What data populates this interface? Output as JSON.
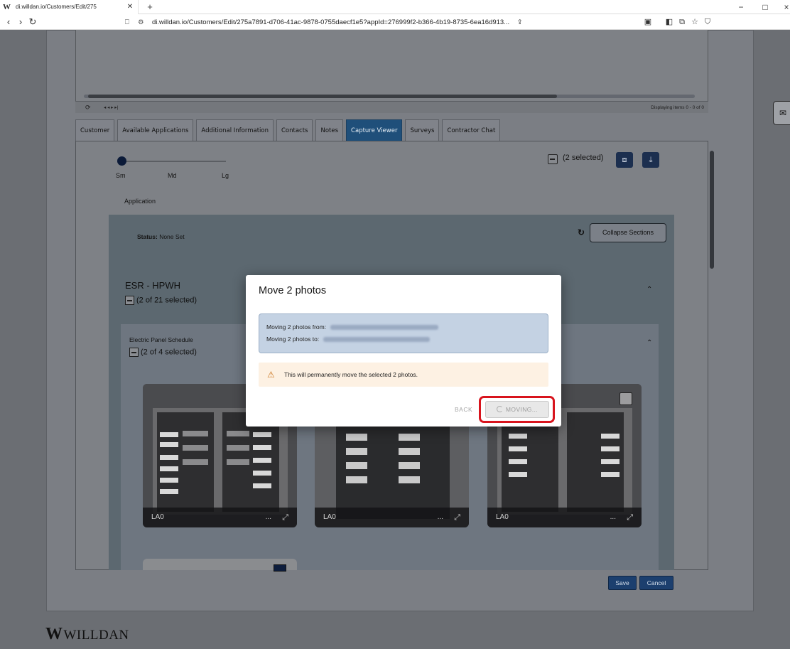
{
  "browser": {
    "tab_title": "di.willdan.io/Customers/Edit/275",
    "favicon": "W",
    "new_tab": "+",
    "url": "di.willdan.io/Customers/Edit/275a7891-d706-41ac-9878-0755daecf1e5?appId=276999f2-b366-4b19-8735-6ea16d913...",
    "window_controls": [
      "−",
      "□",
      "×"
    ]
  },
  "grid": {
    "pager_controls": "◂  ◂   ▸  ▸|",
    "pager_status": "Displaying items 0 - 0 of 0"
  },
  "tabs": [
    {
      "label": "Customer",
      "active": false
    },
    {
      "label": "Available Applications",
      "active": false
    },
    {
      "label": "Additional Information",
      "active": false
    },
    {
      "label": "Contacts",
      "active": false
    },
    {
      "label": "Notes",
      "active": false
    },
    {
      "label": "Capture Viewer",
      "active": true
    },
    {
      "label": "Surveys",
      "active": false
    },
    {
      "label": "Contractor Chat",
      "active": false
    }
  ],
  "viewer": {
    "size_options": [
      "Sm",
      "Md",
      "Lg"
    ],
    "selected_count": "(2 selected)",
    "application_label": "Application",
    "status_label": "Status:",
    "status_value": "None Set",
    "collapse_button": "Collapse Sections"
  },
  "section": {
    "title": "ESR - HPWH",
    "selected": "(2 of 21 selected)",
    "subsection_title": "Electric Panel Schedule",
    "subsection_selected": "(2 of 4 selected)",
    "photos": [
      {
        "caption": "LA0",
        "more": "..."
      },
      {
        "caption": "LA0",
        "more": "..."
      },
      {
        "caption": "LA0",
        "more": "..."
      }
    ]
  },
  "footer_buttons": {
    "save": "Save",
    "cancel": "Cancel"
  },
  "logo": {
    "mark": "W",
    "text": "WILLDAN"
  },
  "modal": {
    "title": "Move 2 photos",
    "from_label": "Moving 2 photos from:",
    "to_label": "Moving 2 photos to:",
    "warning": "This will permanently move the selected 2 photos.",
    "back_button": "BACK",
    "moving_button": "MOVING..."
  },
  "colors": {
    "active_tab": "#1f4f7a",
    "primary_button": "#1c3f6e",
    "highlight": "#d8141d",
    "warning_bg": "#fdf1e3"
  }
}
